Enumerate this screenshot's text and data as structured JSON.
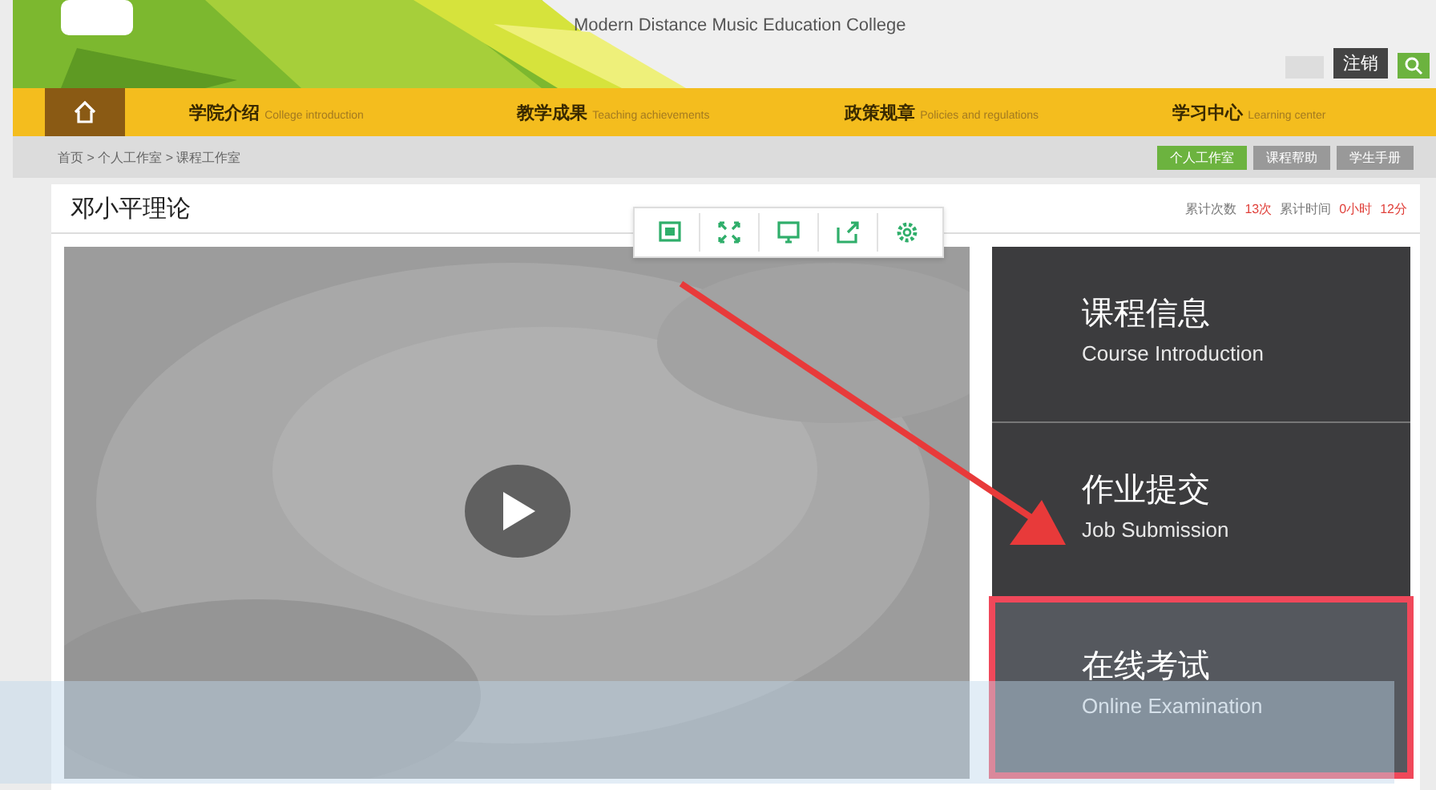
{
  "header": {
    "college_name": "Modern Distance Music Education College",
    "logout_button": "注销"
  },
  "nav": [
    {
      "label": "学院介绍",
      "sublabel": "College introduction"
    },
    {
      "label": "教学成果",
      "sublabel": "Teaching achievements"
    },
    {
      "label": "政策规章",
      "sublabel": "Policies and regulations"
    },
    {
      "label": "学习中心",
      "sublabel": "Learning center"
    }
  ],
  "breadcrumb": "首页 > 个人工作室 > 课程工作室",
  "quick_links": [
    {
      "label": "个人工作室",
      "selected": true
    },
    {
      "label": "课程帮助",
      "selected": false
    },
    {
      "label": "学生手册",
      "selected": false
    }
  ],
  "course": {
    "title": "邓小平理论",
    "stats": [
      {
        "label": "累计次数",
        "value": "13次"
      },
      {
        "label": "累计时间",
        "value": "0小时"
      },
      {
        "value": "12分"
      }
    ]
  },
  "tiles": [
    {
      "title": "课程信息",
      "subtitle": "Course Introduction",
      "highlighted": false
    },
    {
      "title": "作业提交",
      "subtitle": "Job Submission",
      "highlighted": false
    },
    {
      "title": "在线考试",
      "subtitle": "Online Examination",
      "highlighted": true
    }
  ]
}
